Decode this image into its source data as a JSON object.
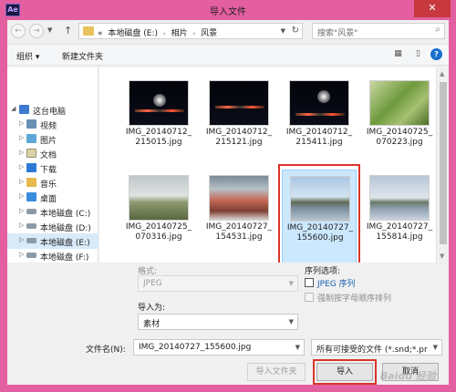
{
  "window": {
    "title": "导入文件",
    "app_icon_text": "Ae",
    "close_glyph": "✕"
  },
  "address": {
    "back_glyph": "←",
    "forward_glyph": "→",
    "up_glyph": "↑",
    "overflow": "«",
    "crumbs": [
      "本地磁盘 (E:)",
      "相片",
      "风景"
    ],
    "separator": "›",
    "search_placeholder": "搜索\"风景\""
  },
  "toolbar": {
    "organize": "组织 ▾",
    "new_folder": "新建文件夹",
    "view_glyph": "▦",
    "pane_glyph": "▯",
    "help_glyph": "?"
  },
  "nav": {
    "items": [
      {
        "label": "这台电脑",
        "icon": "computer-icon"
      },
      {
        "label": "视频",
        "icon": "video-icon"
      },
      {
        "label": "图片",
        "icon": "picture-icon"
      },
      {
        "label": "文档",
        "icon": "document-icon"
      },
      {
        "label": "下载",
        "icon": "download-icon"
      },
      {
        "label": "音乐",
        "icon": "music-icon"
      },
      {
        "label": "桌面",
        "icon": "desktop-icon"
      },
      {
        "label": "本地磁盘 (C:)",
        "icon": "drive-icon"
      },
      {
        "label": "本地磁盘 (D:)",
        "icon": "drive-icon"
      },
      {
        "label": "本地磁盘 (E:)",
        "icon": "drive-icon",
        "selected": true
      },
      {
        "label": "本地磁盘 (F:)",
        "icon": "drive-icon"
      }
    ]
  },
  "files": [
    {
      "name_line1": "IMG_20140712_",
      "name_line2": "215015.jpg"
    },
    {
      "name_line1": "IMG_20140712_",
      "name_line2": "215121.jpg"
    },
    {
      "name_line1": "IMG_20140712_",
      "name_line2": "215411.jpg"
    },
    {
      "name_line1": "IMG_20140725_",
      "name_line2": "070223.jpg"
    },
    {
      "name_line1": "IMG_20140725_",
      "name_line2": "070316.jpg"
    },
    {
      "name_line1": "IMG_20140727_",
      "name_line2": "154531.jpg"
    },
    {
      "name_line1": "IMG_20140727_",
      "name_line2": "155600.jpg",
      "selected": true
    },
    {
      "name_line1": "IMG_20140727_",
      "name_line2": "155814.jpg"
    }
  ],
  "options": {
    "format_label": "格式:",
    "format_value": "JPEG",
    "import_as_label": "导入为:",
    "import_as_value": "素材",
    "sequence_label": "序列选项:",
    "sequence_checkbox": "JPEG 序列",
    "alpha_checkbox": "强制按字母顺序排列"
  },
  "footer": {
    "filename_label": "文件名(N):",
    "filename_value": "IMG_20140727_155600.jpg",
    "filter_value": "所有可接受的文件 (*.snd;*.pr",
    "import_folder": "导入文件夹",
    "import": "导入",
    "cancel": "取消",
    "watermark": "Baidu 经验"
  }
}
